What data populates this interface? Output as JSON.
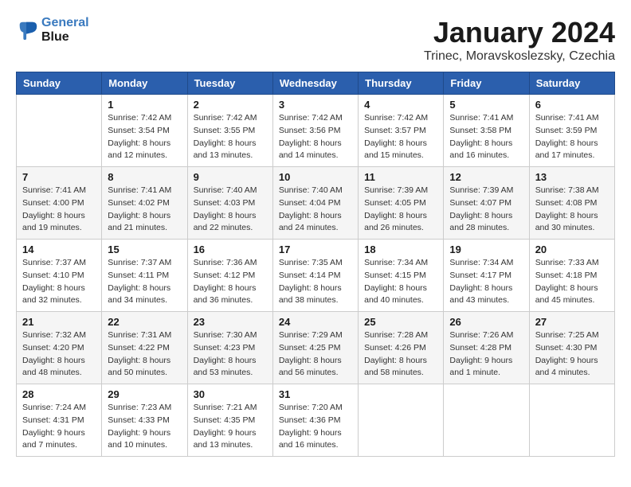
{
  "logo": {
    "line1": "General",
    "line2": "Blue"
  },
  "title": "January 2024",
  "location": "Trinec, Moravskoslezsky, Czechia",
  "weekdays": [
    "Sunday",
    "Monday",
    "Tuesday",
    "Wednesday",
    "Thursday",
    "Friday",
    "Saturday"
  ],
  "weeks": [
    [
      {
        "day": "",
        "sunrise": "",
        "sunset": "",
        "daylight": ""
      },
      {
        "day": "1",
        "sunrise": "Sunrise: 7:42 AM",
        "sunset": "Sunset: 3:54 PM",
        "daylight": "Daylight: 8 hours and 12 minutes."
      },
      {
        "day": "2",
        "sunrise": "Sunrise: 7:42 AM",
        "sunset": "Sunset: 3:55 PM",
        "daylight": "Daylight: 8 hours and 13 minutes."
      },
      {
        "day": "3",
        "sunrise": "Sunrise: 7:42 AM",
        "sunset": "Sunset: 3:56 PM",
        "daylight": "Daylight: 8 hours and 14 minutes."
      },
      {
        "day": "4",
        "sunrise": "Sunrise: 7:42 AM",
        "sunset": "Sunset: 3:57 PM",
        "daylight": "Daylight: 8 hours and 15 minutes."
      },
      {
        "day": "5",
        "sunrise": "Sunrise: 7:41 AM",
        "sunset": "Sunset: 3:58 PM",
        "daylight": "Daylight: 8 hours and 16 minutes."
      },
      {
        "day": "6",
        "sunrise": "Sunrise: 7:41 AM",
        "sunset": "Sunset: 3:59 PM",
        "daylight": "Daylight: 8 hours and 17 minutes."
      }
    ],
    [
      {
        "day": "7",
        "sunrise": "Sunrise: 7:41 AM",
        "sunset": "Sunset: 4:00 PM",
        "daylight": "Daylight: 8 hours and 19 minutes."
      },
      {
        "day": "8",
        "sunrise": "Sunrise: 7:41 AM",
        "sunset": "Sunset: 4:02 PM",
        "daylight": "Daylight: 8 hours and 21 minutes."
      },
      {
        "day": "9",
        "sunrise": "Sunrise: 7:40 AM",
        "sunset": "Sunset: 4:03 PM",
        "daylight": "Daylight: 8 hours and 22 minutes."
      },
      {
        "day": "10",
        "sunrise": "Sunrise: 7:40 AM",
        "sunset": "Sunset: 4:04 PM",
        "daylight": "Daylight: 8 hours and 24 minutes."
      },
      {
        "day": "11",
        "sunrise": "Sunrise: 7:39 AM",
        "sunset": "Sunset: 4:05 PM",
        "daylight": "Daylight: 8 hours and 26 minutes."
      },
      {
        "day": "12",
        "sunrise": "Sunrise: 7:39 AM",
        "sunset": "Sunset: 4:07 PM",
        "daylight": "Daylight: 8 hours and 28 minutes."
      },
      {
        "day": "13",
        "sunrise": "Sunrise: 7:38 AM",
        "sunset": "Sunset: 4:08 PM",
        "daylight": "Daylight: 8 hours and 30 minutes."
      }
    ],
    [
      {
        "day": "14",
        "sunrise": "Sunrise: 7:37 AM",
        "sunset": "Sunset: 4:10 PM",
        "daylight": "Daylight: 8 hours and 32 minutes."
      },
      {
        "day": "15",
        "sunrise": "Sunrise: 7:37 AM",
        "sunset": "Sunset: 4:11 PM",
        "daylight": "Daylight: 8 hours and 34 minutes."
      },
      {
        "day": "16",
        "sunrise": "Sunrise: 7:36 AM",
        "sunset": "Sunset: 4:12 PM",
        "daylight": "Daylight: 8 hours and 36 minutes."
      },
      {
        "day": "17",
        "sunrise": "Sunrise: 7:35 AM",
        "sunset": "Sunset: 4:14 PM",
        "daylight": "Daylight: 8 hours and 38 minutes."
      },
      {
        "day": "18",
        "sunrise": "Sunrise: 7:34 AM",
        "sunset": "Sunset: 4:15 PM",
        "daylight": "Daylight: 8 hours and 40 minutes."
      },
      {
        "day": "19",
        "sunrise": "Sunrise: 7:34 AM",
        "sunset": "Sunset: 4:17 PM",
        "daylight": "Daylight: 8 hours and 43 minutes."
      },
      {
        "day": "20",
        "sunrise": "Sunrise: 7:33 AM",
        "sunset": "Sunset: 4:18 PM",
        "daylight": "Daylight: 8 hours and 45 minutes."
      }
    ],
    [
      {
        "day": "21",
        "sunrise": "Sunrise: 7:32 AM",
        "sunset": "Sunset: 4:20 PM",
        "daylight": "Daylight: 8 hours and 48 minutes."
      },
      {
        "day": "22",
        "sunrise": "Sunrise: 7:31 AM",
        "sunset": "Sunset: 4:22 PM",
        "daylight": "Daylight: 8 hours and 50 minutes."
      },
      {
        "day": "23",
        "sunrise": "Sunrise: 7:30 AM",
        "sunset": "Sunset: 4:23 PM",
        "daylight": "Daylight: 8 hours and 53 minutes."
      },
      {
        "day": "24",
        "sunrise": "Sunrise: 7:29 AM",
        "sunset": "Sunset: 4:25 PM",
        "daylight": "Daylight: 8 hours and 56 minutes."
      },
      {
        "day": "25",
        "sunrise": "Sunrise: 7:28 AM",
        "sunset": "Sunset: 4:26 PM",
        "daylight": "Daylight: 8 hours and 58 minutes."
      },
      {
        "day": "26",
        "sunrise": "Sunrise: 7:26 AM",
        "sunset": "Sunset: 4:28 PM",
        "daylight": "Daylight: 9 hours and 1 minute."
      },
      {
        "day": "27",
        "sunrise": "Sunrise: 7:25 AM",
        "sunset": "Sunset: 4:30 PM",
        "daylight": "Daylight: 9 hours and 4 minutes."
      }
    ],
    [
      {
        "day": "28",
        "sunrise": "Sunrise: 7:24 AM",
        "sunset": "Sunset: 4:31 PM",
        "daylight": "Daylight: 9 hours and 7 minutes."
      },
      {
        "day": "29",
        "sunrise": "Sunrise: 7:23 AM",
        "sunset": "Sunset: 4:33 PM",
        "daylight": "Daylight: 9 hours and 10 minutes."
      },
      {
        "day": "30",
        "sunrise": "Sunrise: 7:21 AM",
        "sunset": "Sunset: 4:35 PM",
        "daylight": "Daylight: 9 hours and 13 minutes."
      },
      {
        "day": "31",
        "sunrise": "Sunrise: 7:20 AM",
        "sunset": "Sunset: 4:36 PM",
        "daylight": "Daylight: 9 hours and 16 minutes."
      },
      {
        "day": "",
        "sunrise": "",
        "sunset": "",
        "daylight": ""
      },
      {
        "day": "",
        "sunrise": "",
        "sunset": "",
        "daylight": ""
      },
      {
        "day": "",
        "sunrise": "",
        "sunset": "",
        "daylight": ""
      }
    ]
  ]
}
